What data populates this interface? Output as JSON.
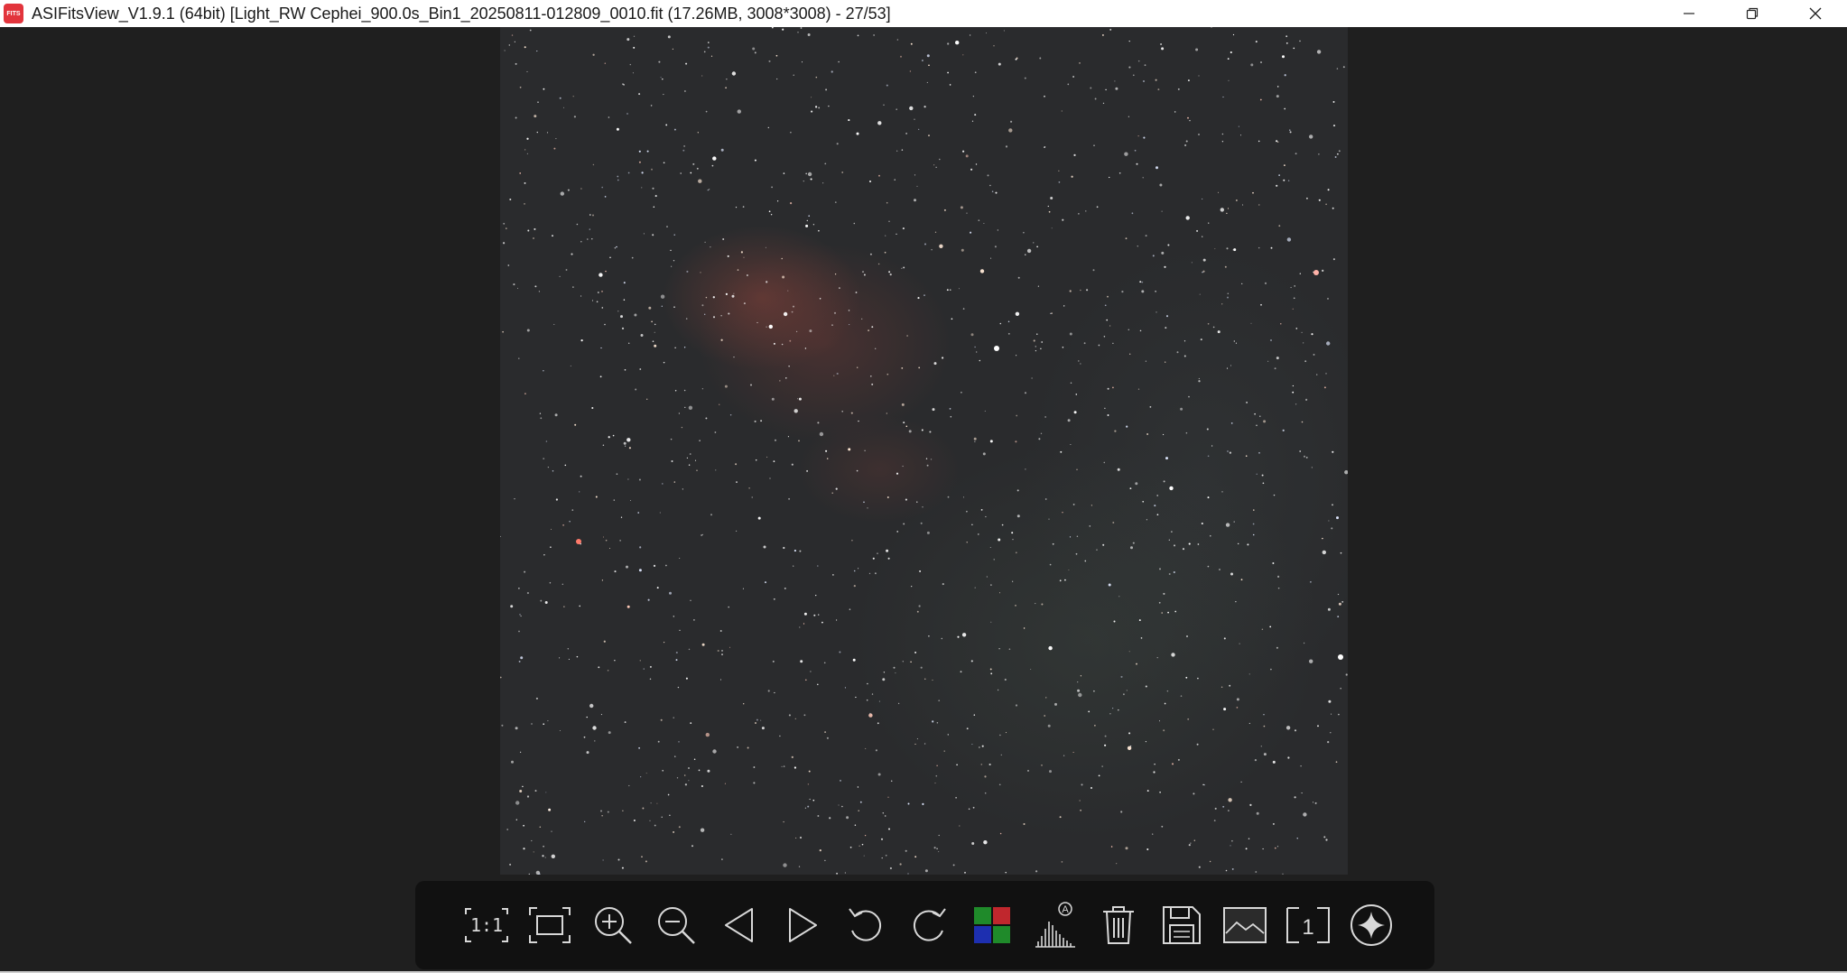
{
  "window": {
    "title": "ASIFitsView_V1.9.1 (64bit) [Light_RW Cephei_900.0s_Bin1_20250811-012809_0010.fit (17.26MB, 3008*3008) - 27/53]",
    "app_icon_text": "FITS",
    "controls": [
      "minimize-icon",
      "restore-icon",
      "close-icon"
    ]
  },
  "toolbar": {
    "items": [
      {
        "name": "actual-size-button",
        "label": "1:1",
        "icon": "one-to-one-icon"
      },
      {
        "name": "fit-window-button",
        "icon": "fit-screen-icon"
      },
      {
        "name": "zoom-in-button",
        "icon": "zoom-in-icon"
      },
      {
        "name": "zoom-out-button",
        "icon": "zoom-out-icon"
      },
      {
        "name": "previous-image-button",
        "icon": "triangle-left-icon"
      },
      {
        "name": "next-image-button",
        "icon": "triangle-right-icon"
      },
      {
        "name": "rotate-left-button",
        "icon": "rotate-ccw-icon"
      },
      {
        "name": "rotate-right-button",
        "icon": "rotate-cw-icon"
      },
      {
        "name": "debayer-button",
        "icon": "rgb-grid-icon"
      },
      {
        "name": "auto-stretch-button",
        "label": "A",
        "icon": "histogram-auto-icon"
      },
      {
        "name": "delete-button",
        "icon": "trash-icon"
      },
      {
        "name": "save-button",
        "icon": "floppy-disk-icon"
      },
      {
        "name": "thumbnail-button",
        "icon": "image-landscape-icon"
      },
      {
        "name": "single-view-button",
        "label": "1",
        "icon": "single-frame-icon"
      },
      {
        "name": "star-button",
        "icon": "star-sparkle-icon"
      }
    ]
  },
  "colors": {
    "background": "#1f1f1f",
    "toolbar_bg": "#111111",
    "icon": "#d8d8d8",
    "titlebar_bg": "#ffffff",
    "nebula": "#964640"
  }
}
